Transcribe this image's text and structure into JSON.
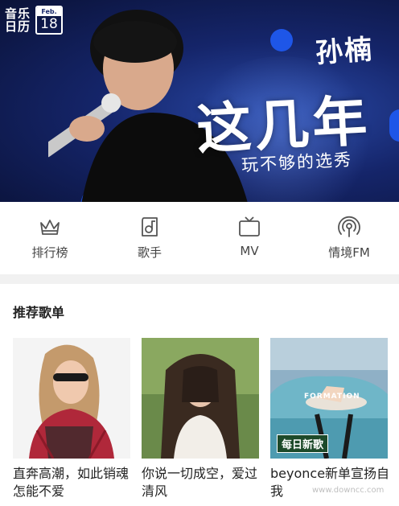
{
  "banner": {
    "calendar_label": "音乐日历",
    "calendar_month": "Feb.",
    "calendar_day": "18",
    "artist": "孙楠",
    "album_title": "这几年",
    "album_subtitle": "玩不够的选秀"
  },
  "categories": [
    {
      "label": "排行榜",
      "icon": "crown-icon"
    },
    {
      "label": "歌手",
      "icon": "singer-icon"
    },
    {
      "label": "MV",
      "icon": "tv-icon"
    },
    {
      "label": "情境FM",
      "icon": "radio-icon"
    }
  ],
  "recommend": {
    "title": "推荐歌单",
    "playlists": [
      {
        "title": "直奔高潮，如此销魂怎能不爱"
      },
      {
        "title": "你说一切成空，爱过清风"
      },
      {
        "title": "beyonce新单宣扬自我",
        "cover_text_1": "FORMATION",
        "cover_text_2": "每日新歌"
      }
    ]
  },
  "watermark": "www.downcc.com",
  "colors": {
    "banner_dark": "#0a1238",
    "accent_blue": "#1e56e8",
    "divider": "#f1f1f1"
  }
}
